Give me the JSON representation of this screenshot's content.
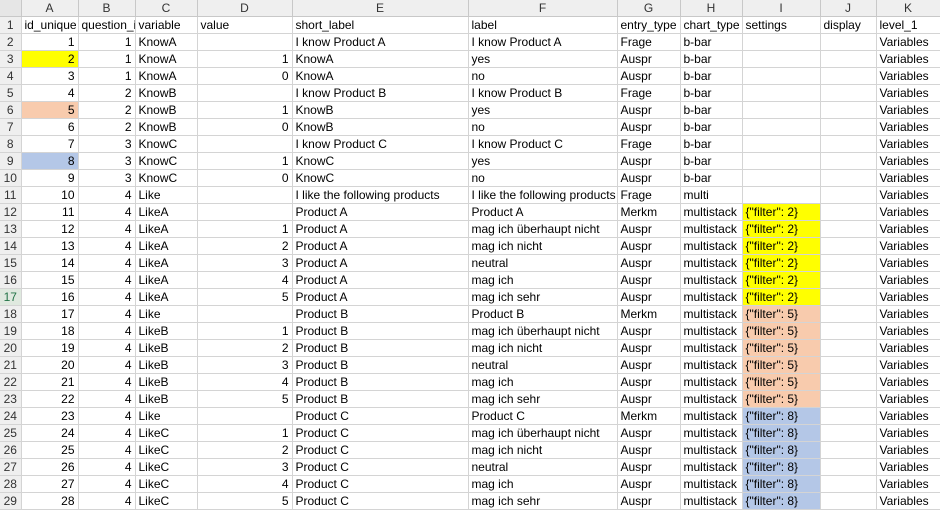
{
  "column_letters": [
    "A",
    "B",
    "C",
    "D",
    "E",
    "F",
    "G",
    "H",
    "I",
    "J",
    "K"
  ],
  "colors": {
    "yellow": "#ffff00",
    "peach": "#f8cbad",
    "blue": "#b4c7e7"
  },
  "rows": [
    {
      "n": "1",
      "cells": [
        "id_unique",
        "question_i",
        "variable",
        "value",
        "short_label",
        "label",
        "entry_type",
        "chart_type",
        "settings",
        "display",
        "level_1"
      ]
    },
    {
      "n": "2",
      "cells": [
        "1",
        "1",
        "KnowA",
        "",
        "I know Product A",
        "I know Product A",
        "Frage",
        "b-bar",
        "",
        "",
        "Variables"
      ]
    },
    {
      "n": "3",
      "cells": [
        "2",
        "1",
        "KnowA",
        "1",
        "KnowA",
        "yes",
        "Auspr",
        "b-bar",
        "",
        "",
        "Variables"
      ],
      "hlA": "yellow"
    },
    {
      "n": "4",
      "cells": [
        "3",
        "1",
        "KnowA",
        "0",
        "KnowA",
        "no",
        "Auspr",
        "b-bar",
        "",
        "",
        "Variables"
      ]
    },
    {
      "n": "5",
      "cells": [
        "4",
        "2",
        "KnowB",
        "",
        "I know Product B",
        "I know Product B",
        "Frage",
        "b-bar",
        "",
        "",
        "Variables"
      ]
    },
    {
      "n": "6",
      "cells": [
        "5",
        "2",
        "KnowB",
        "1",
        "KnowB",
        "yes",
        "Auspr",
        "b-bar",
        "",
        "",
        "Variables"
      ],
      "hlA": "peach"
    },
    {
      "n": "7",
      "cells": [
        "6",
        "2",
        "KnowB",
        "0",
        "KnowB",
        "no",
        "Auspr",
        "b-bar",
        "",
        "",
        "Variables"
      ]
    },
    {
      "n": "8",
      "cells": [
        "7",
        "3",
        "KnowC",
        "",
        "I know Product C",
        "I know Product C",
        "Frage",
        "b-bar",
        "",
        "",
        "Variables"
      ]
    },
    {
      "n": "9",
      "cells": [
        "8",
        "3",
        "KnowC",
        "1",
        "KnowC",
        "yes",
        "Auspr",
        "b-bar",
        "",
        "",
        "Variables"
      ],
      "hlA": "blue"
    },
    {
      "n": "10",
      "cells": [
        "9",
        "3",
        "KnowC",
        "0",
        "KnowC",
        "no",
        "Auspr",
        "b-bar",
        "",
        "",
        "Variables"
      ]
    },
    {
      "n": "11",
      "cells": [
        "10",
        "4",
        "Like",
        "",
        "I like the following products",
        "I like the following products",
        "Frage",
        "multi",
        "",
        "",
        "Variables"
      ]
    },
    {
      "n": "12",
      "cells": [
        "11",
        "4",
        "LikeA",
        "",
        "Product A",
        "Product A",
        "Merkm",
        "multistack",
        "{\"filter\": 2}",
        "",
        "Variables"
      ],
      "hlI": "yellow"
    },
    {
      "n": "13",
      "cells": [
        "12",
        "4",
        "LikeA",
        "1",
        "Product A",
        "mag ich überhaupt nicht",
        "Auspr",
        "multistack",
        "{\"filter\": 2}",
        "",
        "Variables"
      ],
      "hlI": "yellow"
    },
    {
      "n": "14",
      "cells": [
        "13",
        "4",
        "LikeA",
        "2",
        "Product A",
        "mag ich nicht",
        "Auspr",
        "multistack",
        "{\"filter\": 2}",
        "",
        "Variables"
      ],
      "hlI": "yellow"
    },
    {
      "n": "15",
      "cells": [
        "14",
        "4",
        "LikeA",
        "3",
        "Product A",
        "neutral",
        "Auspr",
        "multistack",
        "{\"filter\": 2}",
        "",
        "Variables"
      ],
      "hlI": "yellow"
    },
    {
      "n": "16",
      "cells": [
        "15",
        "4",
        "LikeA",
        "4",
        "Product A",
        "mag ich",
        "Auspr",
        "multistack",
        "{\"filter\": 2}",
        "",
        "Variables"
      ],
      "hlI": "yellow"
    },
    {
      "n": "17",
      "cells": [
        "16",
        "4",
        "LikeA",
        "5",
        "Product A",
        "mag ich sehr",
        "Auspr",
        "multistack",
        "{\"filter\": 2}",
        "",
        "Variables"
      ],
      "hlI": "yellow",
      "sel": true
    },
    {
      "n": "18",
      "cells": [
        "17",
        "4",
        "Like",
        "",
        "Product B",
        "Product B",
        "Merkm",
        "multistack",
        "{\"filter\": 5}",
        "",
        "Variables"
      ],
      "hlI": "peach"
    },
    {
      "n": "19",
      "cells": [
        "18",
        "4",
        "LikeB",
        "1",
        "Product B",
        "mag ich überhaupt nicht",
        "Auspr",
        "multistack",
        "{\"filter\": 5}",
        "",
        "Variables"
      ],
      "hlI": "peach"
    },
    {
      "n": "20",
      "cells": [
        "19",
        "4",
        "LikeB",
        "2",
        "Product B",
        "mag ich nicht",
        "Auspr",
        "multistack",
        "{\"filter\": 5}",
        "",
        "Variables"
      ],
      "hlI": "peach"
    },
    {
      "n": "21",
      "cells": [
        "20",
        "4",
        "LikeB",
        "3",
        "Product B",
        "neutral",
        "Auspr",
        "multistack",
        "{\"filter\": 5}",
        "",
        "Variables"
      ],
      "hlI": "peach"
    },
    {
      "n": "22",
      "cells": [
        "21",
        "4",
        "LikeB",
        "4",
        "Product B",
        "mag ich",
        "Auspr",
        "multistack",
        "{\"filter\": 5}",
        "",
        "Variables"
      ],
      "hlI": "peach"
    },
    {
      "n": "23",
      "cells": [
        "22",
        "4",
        "LikeB",
        "5",
        "Product B",
        "mag ich sehr",
        "Auspr",
        "multistack",
        "{\"filter\": 5}",
        "",
        "Variables"
      ],
      "hlI": "peach"
    },
    {
      "n": "24",
      "cells": [
        "23",
        "4",
        "Like",
        "",
        "Product C",
        "Product C",
        "Merkm",
        "multistack",
        "{\"filter\": 8}",
        "",
        "Variables"
      ],
      "hlI": "blue"
    },
    {
      "n": "25",
      "cells": [
        "24",
        "4",
        "LikeC",
        "1",
        "Product C",
        "mag ich überhaupt nicht",
        "Auspr",
        "multistack",
        "{\"filter\": 8}",
        "",
        "Variables"
      ],
      "hlI": "blue"
    },
    {
      "n": "26",
      "cells": [
        "25",
        "4",
        "LikeC",
        "2",
        "Product C",
        "mag ich nicht",
        "Auspr",
        "multistack",
        "{\"filter\": 8}",
        "",
        "Variables"
      ],
      "hlI": "blue"
    },
    {
      "n": "27",
      "cells": [
        "26",
        "4",
        "LikeC",
        "3",
        "Product C",
        "neutral",
        "Auspr",
        "multistack",
        "{\"filter\": 8}",
        "",
        "Variables"
      ],
      "hlI": "blue"
    },
    {
      "n": "28",
      "cells": [
        "27",
        "4",
        "LikeC",
        "4",
        "Product C",
        "mag ich",
        "Auspr",
        "multistack",
        "{\"filter\": 8}",
        "",
        "Variables"
      ],
      "hlI": "blue"
    },
    {
      "n": "29",
      "cells": [
        "28",
        "4",
        "LikeC",
        "5",
        "Product C",
        "mag ich sehr",
        "Auspr",
        "multistack",
        "{\"filter\": 8}",
        "",
        "Variables"
      ],
      "hlI": "blue"
    }
  ]
}
